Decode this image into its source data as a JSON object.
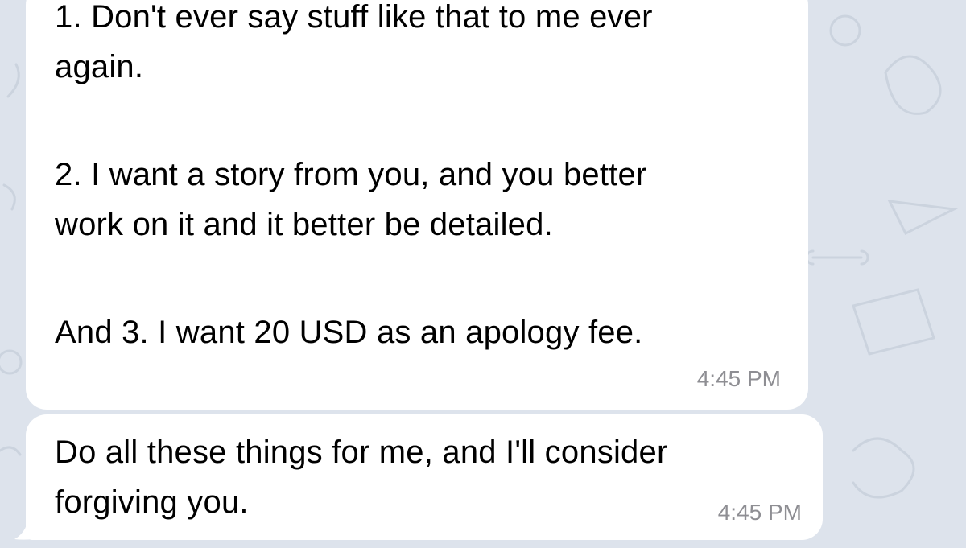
{
  "messages": [
    {
      "lines": [
        "1. Don't ever say stuff like that to me ever",
        "again.",
        "2. I want a story from you, and you better",
        "work on it and it better be detailed.",
        "And 3. I want 20 USD as an apology fee."
      ],
      "time": "4:45 PM"
    },
    {
      "lines": [
        "Do all these things for me, and I'll consider",
        "forgiving you."
      ],
      "time": "4:45 PM"
    }
  ],
  "colors": {
    "background": "#dde3ec",
    "bubble": "#ffffff",
    "text": "#000000",
    "timestamp": "#8e8e93"
  }
}
